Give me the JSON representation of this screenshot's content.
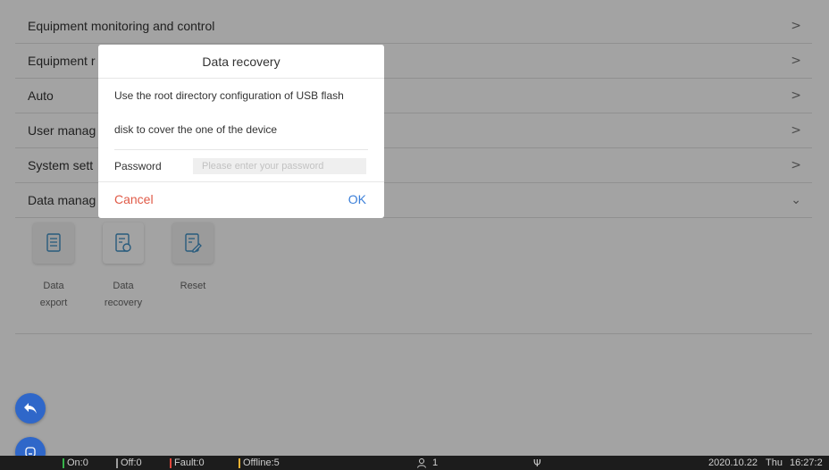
{
  "menu": {
    "items": [
      {
        "label": "Equipment monitoring and control",
        "chevron": ">"
      },
      {
        "label": "Equipment r",
        "chevron": ">"
      },
      {
        "label": "Auto",
        "chevron": ">"
      },
      {
        "label": "User manag",
        "chevron": ">"
      },
      {
        "label": "System sett",
        "chevron": ">"
      },
      {
        "label": "Data manag",
        "chevron": "⌄"
      }
    ]
  },
  "data_management": {
    "tiles": [
      {
        "label_line1": "Data",
        "label_line2": "export",
        "icon": "document-list-icon"
      },
      {
        "label_line1": "Data",
        "label_line2": "recovery",
        "icon": "document-restore-icon"
      },
      {
        "label_line1": "Reset",
        "label_line2": "",
        "icon": "document-edit-icon"
      }
    ]
  },
  "dialog": {
    "title": "Data recovery",
    "message_line1": "Use the root directory configuration of USB flash",
    "message_line2": "disk to cover the one of the device",
    "password_label": "Password",
    "password_placeholder": "Please enter your password",
    "cancel_label": "Cancel",
    "ok_label": "OK"
  },
  "statusbar": {
    "on": "On:0",
    "off": "Off:0",
    "fault": "Fault:0",
    "offline": "Offline:5",
    "users": "1",
    "usb_icon": "Ψ",
    "date": "2020.10.22",
    "weekday": "Thu",
    "time": "16:27:2"
  },
  "colors": {
    "accent": "#2f67c9",
    "cancel": "#e05a47",
    "ok": "#3b7fd9",
    "on_bar": "#36b24a",
    "off_bar": "#9e9e9e",
    "fault_bar": "#e0463b",
    "offline_bar": "#f2b233"
  }
}
